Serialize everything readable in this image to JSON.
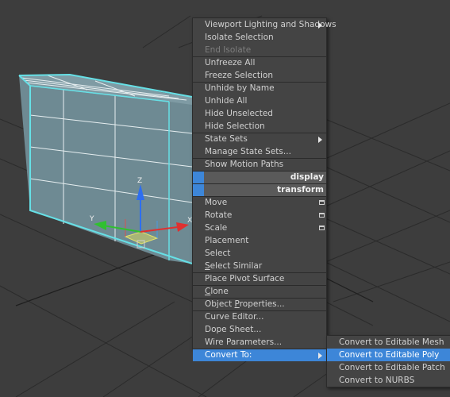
{
  "quad_menu": {
    "items": [
      {
        "label": "Viewport Lighting and Shadows",
        "arrow": true
      },
      {
        "label": "Isolate Selection"
      },
      {
        "label": "End Isolate",
        "disabled": true
      },
      {
        "label": "Unfreeze All"
      },
      {
        "label": "Freeze Selection"
      },
      {
        "label": "Unhide by Name"
      },
      {
        "label": "Unhide All"
      },
      {
        "label": "Hide Unselected"
      },
      {
        "label": "Hide Selection"
      },
      {
        "label": "State Sets",
        "arrow": true
      },
      {
        "label": "Manage State Sets..."
      },
      {
        "label": "Show Motion Paths"
      },
      {
        "label": "display",
        "header": true
      },
      {
        "label": "transform",
        "header": true
      },
      {
        "label": "Move",
        "options": true
      },
      {
        "label": "Rotate",
        "options": true
      },
      {
        "label": "Scale",
        "options": true
      },
      {
        "label": "Placement"
      },
      {
        "label": "Select"
      },
      {
        "label": "Select Similar"
      },
      {
        "label": "Place Pivot Surface"
      },
      {
        "label": "Clone"
      },
      {
        "label": "Object Properties..."
      },
      {
        "label": "Curve Editor..."
      },
      {
        "label": "Dope Sheet..."
      },
      {
        "label": "Wire Parameters..."
      },
      {
        "label": "Convert To:",
        "arrow": true,
        "highlight": true
      }
    ]
  },
  "convert_submenu": {
    "items": [
      {
        "label": "Convert to Editable Mesh"
      },
      {
        "label": "Convert to Editable Poly",
        "highlight": true
      },
      {
        "label": "Convert to Editable Patch"
      },
      {
        "label": "Convert to NURBS"
      }
    ]
  },
  "gizmo": {
    "x_label": "X",
    "y_label": "Y",
    "z_label": "Z"
  },
  "colors": {
    "menu_bg": "#444444",
    "highlight": "#3d86d8",
    "box_face": "#6e8a93",
    "box_edge": "#66e0e6",
    "grid": "#2d2d2d"
  }
}
